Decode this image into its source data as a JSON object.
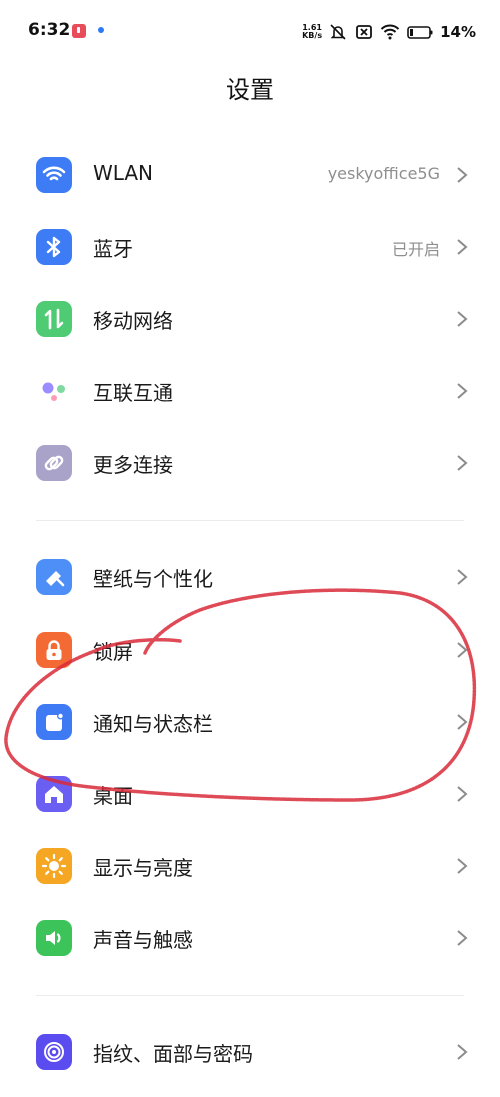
{
  "status_bar": {
    "time": "6:32",
    "net_speed_value": "1.61",
    "net_speed_unit": "KB/s",
    "battery_percent": "14%"
  },
  "header": {
    "title": "设置"
  },
  "connectivity": [
    {
      "label": "WLAN",
      "value": "yeskyoffice5G",
      "icon": "wifi-icon",
      "color": "#3d7cf5"
    },
    {
      "label": "蓝牙",
      "value": "已开启",
      "icon": "bluetooth-icon",
      "color": "#3d7cf5"
    },
    {
      "label": "移动网络",
      "value": "",
      "icon": "mobile-data-icon",
      "color": "#4fcb73"
    },
    {
      "label": "互联互通",
      "value": "",
      "icon": "interconnect-icon",
      "color": "#9b8cff"
    },
    {
      "label": "更多连接",
      "value": "",
      "icon": "link-icon",
      "color": "#aaa3c9"
    }
  ],
  "personalization": [
    {
      "label": "壁纸与个性化",
      "icon": "wallpaper-icon",
      "color": "#4d8ff6"
    },
    {
      "label": "锁屏",
      "icon": "lock-icon",
      "color": "#f46a34"
    },
    {
      "label": "通知与状态栏",
      "icon": "notification-icon",
      "color": "#3f7af5"
    },
    {
      "label": "桌面",
      "icon": "home-icon",
      "color": "#6b5ef2"
    },
    {
      "label": "显示与亮度",
      "icon": "brightness-icon",
      "color": "#f5a623"
    },
    {
      "label": "声音与触感",
      "icon": "sound-icon",
      "color": "#3cc45b"
    }
  ],
  "security": [
    {
      "label": "指纹、面部与密码",
      "icon": "fingerprint-icon",
      "color": "#5b4cf0"
    }
  ]
}
